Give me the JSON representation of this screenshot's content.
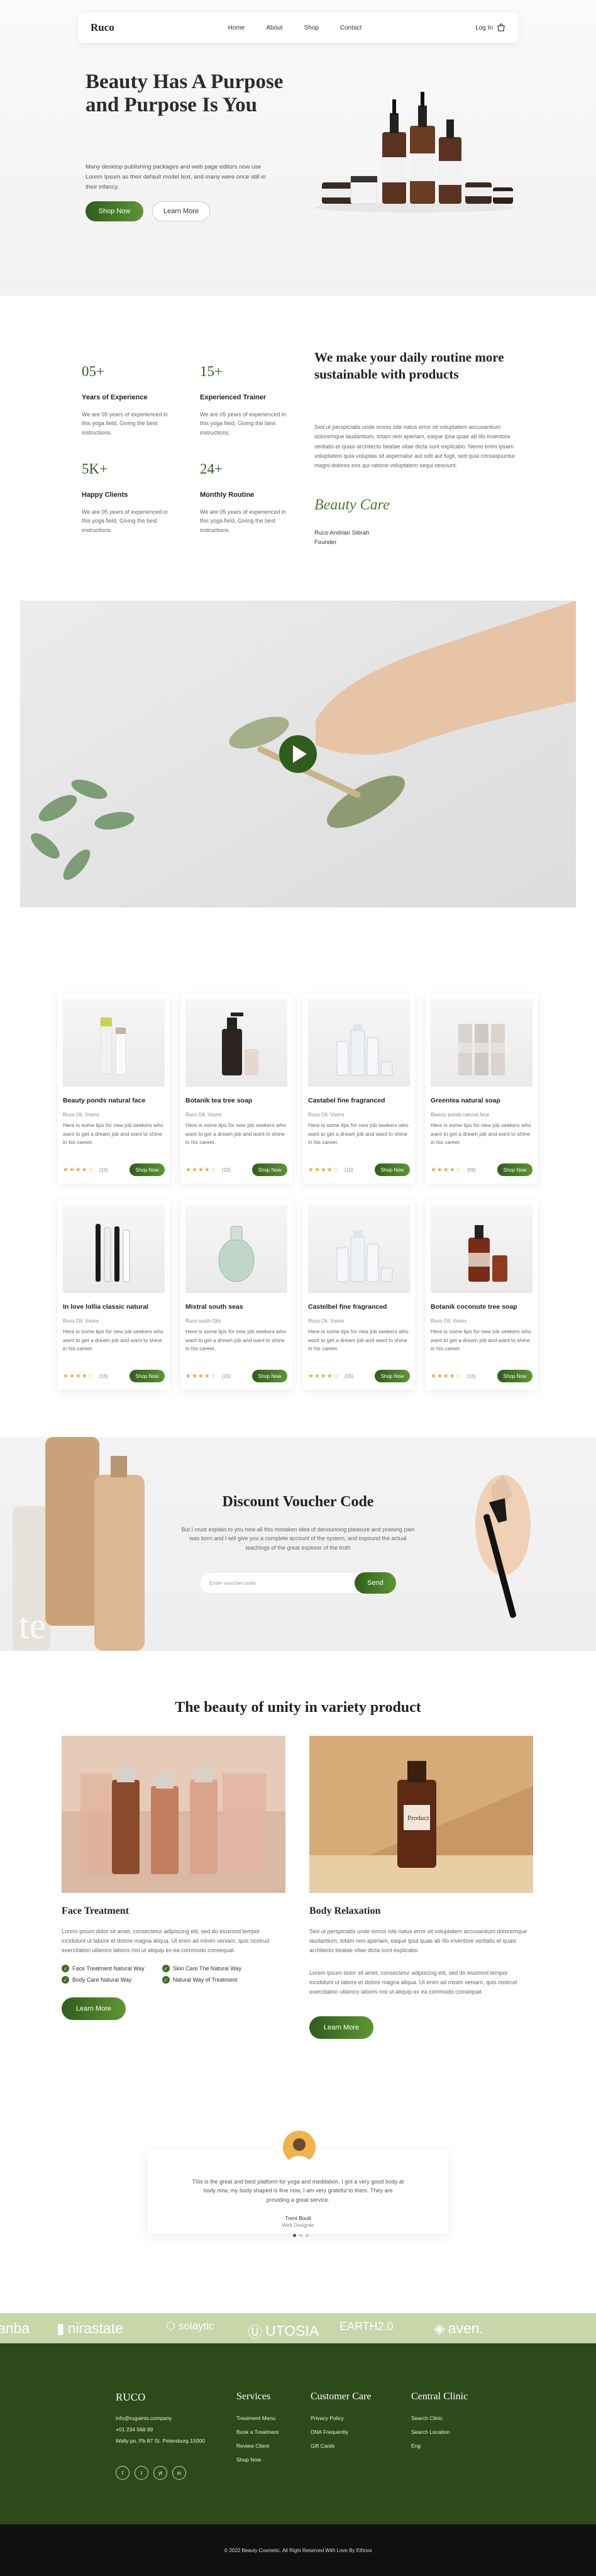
{
  "header": {
    "logo": "Ruco",
    "nav": [
      "Home",
      "About",
      "Shop",
      "Contact"
    ],
    "login": "Log In"
  },
  "hero": {
    "title": "Beauty Has A Purpose and Purpose Is You",
    "text": "Many desktop publishing packages and web page editors now use Lorem Ipsum as their default model text, and many were once still in their infancy.",
    "shop_button": "Shop Now",
    "learn_button": "Learn More"
  },
  "stats": [
    {
      "num": "05+",
      "label": "Years of Experience",
      "desc": "We are 05 years of experienced in this yoga field, Giving the best instructions."
    },
    {
      "num": "15+",
      "label": "Experienced Trainer",
      "desc": "We are 05 years of experienced in this yoga field, Giving the best instructions."
    },
    {
      "num": "5K+",
      "label": "Happy Clients",
      "desc": "We are 05 years of experienced in this yoga field, Giving the best instructions."
    },
    {
      "num": "24+",
      "label": "Monthly Routine",
      "desc": "We are 05 years of experienced in this yoga field, Giving the best instructions."
    }
  ],
  "sustain": {
    "title": "We make your daily routine more sustainable with products",
    "text": "Sed ut perspiciatis unde omnis iste natus error sit voluptatem accusantium doloremque laudantium, totam rem aperiam, eaque ipsa quae ab illo inventore veritatis et quasi architecto beatae vitae dicta sunt explicabo. Nemo enim ipsam voluptatem quia voluptas sit aspernatur aut odit aut fugit, sed quia consequuntur magni dolores eos qui ratione voluptatem sequi nesciunt.",
    "signature": "Beauty Care",
    "founder_name": "Ruco Andrian Sibrah",
    "founder_role": "Founder"
  },
  "products": [
    {
      "name": "Beauty ponds natural face",
      "brand": "Ruco Oil, Vsons",
      "desc": "Here is some tips for new job seekers who want to get a dream job and want to shine in his career.",
      "stars": "★★★★☆",
      "count": "(15)",
      "button": "Shop Now",
      "kind": "tubes"
    },
    {
      "name": "Botanik tea tree soap",
      "brand": "Ruco Oil, Vsons",
      "desc": "Here is some tips for new job seekers who want to get a dream job and want to shine in his career.",
      "stars": "★★★★☆",
      "count": "(15)",
      "button": "Shop Now",
      "kind": "pump"
    },
    {
      "name": "Castabel fine fragranced",
      "brand": "Ruco Oil, Vsons",
      "desc": "Here is some tips for new job seekers who want to get a dream job and want to shine in his career.",
      "stars": "★★★★☆",
      "count": "(15)",
      "button": "Shop Now",
      "kind": "clear"
    },
    {
      "name": "Greentea natural soap",
      "brand": "Beauty ponds natural face",
      "desc": "Here is some tips for new job seekers who want to get a dream job and want to shine in his career.",
      "stars": "★★★★☆",
      "count": "(09)",
      "button": "Shop Now",
      "kind": "grey"
    },
    {
      "name": "In love lollia classic natural",
      "brand": "Ruco Oil, Vsons",
      "desc": "Here is some tips for new job seekers who want to get a dream job and want to shine in his career.",
      "stars": "★★★★☆",
      "count": "(15)",
      "button": "Shop Now",
      "kind": "mascara"
    },
    {
      "name": "Mistral south seas",
      "brand": "Ruco south Oils",
      "desc": "Here is some tips for new job seekers who want to get a dream job and want to shine in his career.",
      "stars": "★★★★☆",
      "count": "(15)",
      "button": "Shop Now",
      "kind": "perfume"
    },
    {
      "name": "Castelbel fine fragranced",
      "brand": "Ruco Oil, Vsons",
      "desc": "Here is some tips for new job seekers who want to get a dream job and want to shine in his career.",
      "stars": "★★★★☆",
      "count": "(15)",
      "button": "Shop Now",
      "kind": "clear"
    },
    {
      "name": "Botanik coconute tree soap",
      "brand": "Ruco Oil, Vsons",
      "desc": "Here is some tips for new job seekers who want to get a dream job and want to shine in his career.",
      "stars": "★★★★☆",
      "count": "(15)",
      "button": "Shop Now",
      "kind": "amber"
    }
  ],
  "voucher": {
    "title": "Discount Voucher Code",
    "text": "But I must explain to you how all this mistaken idea of denouncing pleasure and praising pain was born and I will give you a complete account of the system, and expound the actual teachings of the great explorer of the truth",
    "placeholder": "Enter voucher code",
    "button": "Send"
  },
  "unity": {
    "title": "The beauty of unity in variety product",
    "left": {
      "heading": "Face Treatment",
      "text": "Lorem ipsum dolor sit amet, consectetur adipiscing elit, sed do eiusmod tempor incididunt ut labore et dolore magna aliqua. Ut enim ad minim veniam, quis nostrud exercitation ullamco laboris nisi ut aliquip ex ea commodo consequat.",
      "checks": [
        "Face Treatment Natural Way",
        "Skin Care The Natural Way",
        "Body Care Natural Way",
        "Natural Way of Treatment"
      ],
      "button": "Learn More"
    },
    "right": {
      "heading": "Body Relaxation",
      "text1": "Sed ut perspiciatis unde omnis iste natus error sit voluptatem accusantium doloremque laudantium, totam rem aperiam, eaque ipsa quae ab illo inventore veritatis et quasi architecto beatae vitae dicta sunt explicabo.",
      "text2": "Lorem ipsum dolor sit amet, consectetur adipiscing elit, sed do eiusmod tempor incididunt ut labore et dolore magna aliqua. Ut enim ad minim veniam, quis nostrud exercitation ullamco laboris nisi ut aliquip ex ea commodo consequat.",
      "button": "Learn More"
    }
  },
  "testimonial": {
    "text": "This is the great and best platform for yoga and meditation. I got a very good body at body now, my body shaped is fine now, I am very grateful to them. They are providing a great service.",
    "name": "Trent Boult",
    "role": "Web Designer"
  },
  "brands": [
    "anba",
    "nirastate",
    "solaytic",
    "UTOSIA",
    "EARTH2.0",
    "aven."
  ],
  "footer": {
    "logo": "RUCO",
    "email": "info@rugaints.company",
    "phone": "+01 234 568 89",
    "address": "Wally po, Pb 87 St. Petersburg 15000",
    "services_title": "Services",
    "services": [
      "Treatment Menu",
      "Book a Treatment",
      "Review Client",
      "Shop Now"
    ],
    "care_title": "Customer Care",
    "care": [
      "Privacy Policy",
      "DNA Frequently",
      "Gift Cards"
    ],
    "clinic_title": "Central Clinic",
    "clinic": [
      "Search Clinic",
      "Search Location",
      "Eng"
    ],
    "social": [
      "f",
      "t",
      "yt",
      "in"
    ],
    "copyright": "© 2022 Beauty Cosmetic. All Right Reserved With Love By Ethnux"
  },
  "colors": {
    "accent": "#2f5d1c",
    "brand_band": "#c8d6aa",
    "footer": "#2d4a1a"
  }
}
